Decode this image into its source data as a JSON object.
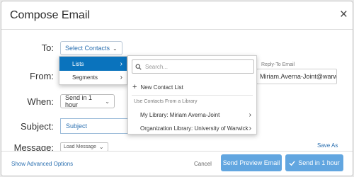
{
  "dialog": {
    "title": "Compose Email",
    "close_glyph": "×"
  },
  "form": {
    "to_label": "To:",
    "from_label": "From:",
    "when_label": "When:",
    "subject_label": "Subject:",
    "message_label": "Message:",
    "select_contacts": "Select Contacts",
    "reply_to_label": "Reply-To Email",
    "reply_to_value": "Miriam.Averna-Joint@warwic",
    "send_in": "Send in 1 hour",
    "subject_value": "Subject",
    "load_message": "Load Message",
    "save_as": "Save As"
  },
  "menu_level1": {
    "items": [
      {
        "label": "Lists",
        "active": true
      },
      {
        "label": "Segments",
        "active": false
      }
    ]
  },
  "menu_level2": {
    "search_placeholder": "Search...",
    "new_contact_list": "New Contact List",
    "section_header": "Use Contacts From a Library",
    "libraries": [
      {
        "label": "My Library: Miriam Averna-Joint"
      },
      {
        "label": "Organization Library: University of Warwick"
      }
    ]
  },
  "footer": {
    "advanced_options": "Show Advanced Options",
    "cancel": "Cancel",
    "send_preview": "Send Preview Email",
    "send_in_hour": "Send in 1 hour"
  },
  "icons": {
    "close": "close-icon",
    "search": "search-icon",
    "plus": "plus-icon",
    "chevron_right": "chevron-right-icon",
    "chevron_down": "chevron-down-icon",
    "check": "check-icon"
  },
  "colors": {
    "accent": "#0a73bd",
    "primary_button": "#62a6e0",
    "link": "#2a6fb0"
  }
}
